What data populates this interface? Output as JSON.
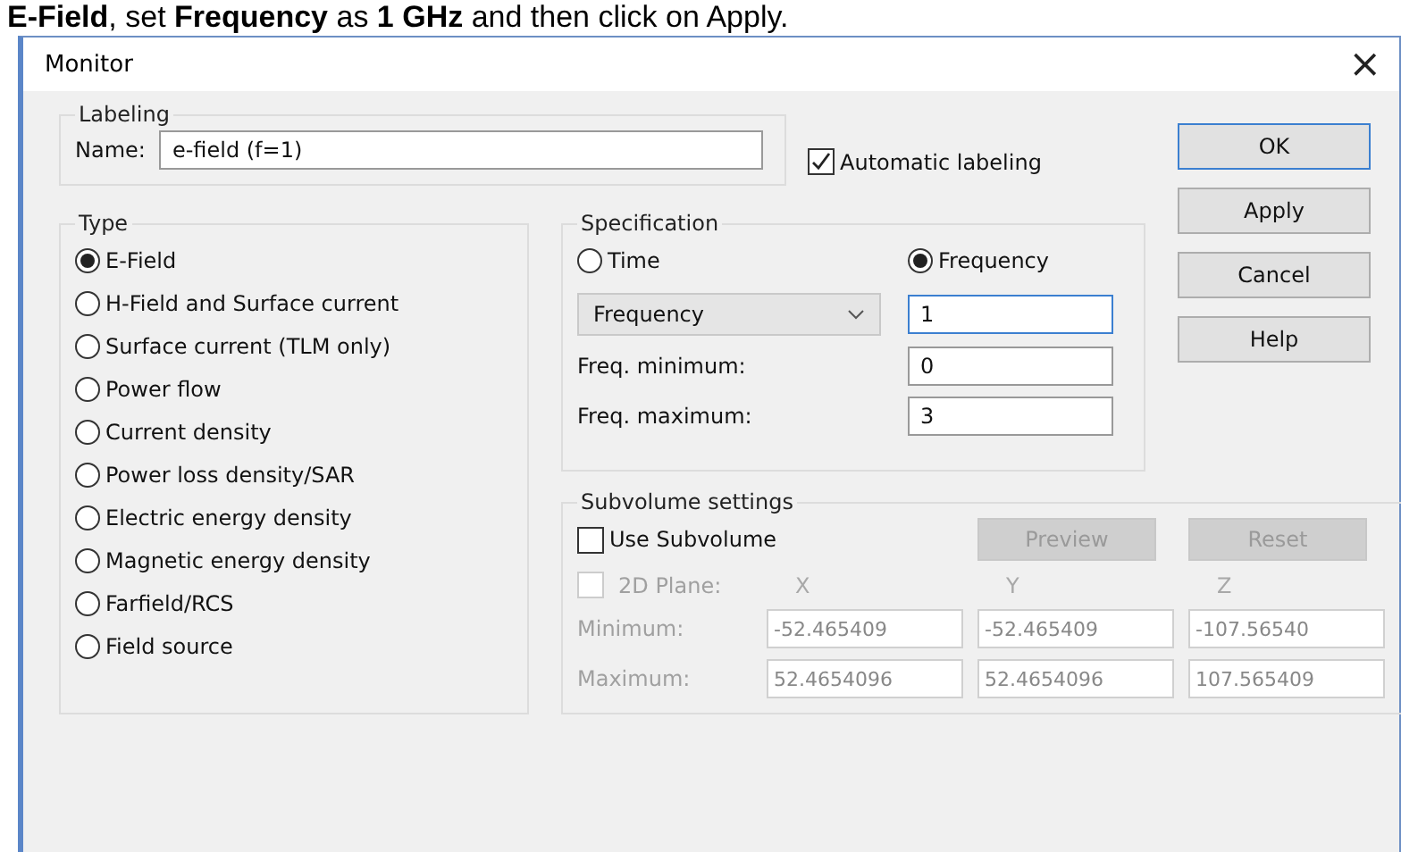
{
  "caption": "**E-Field**, set **Frequency** as **1 GHz** and then click on Apply.",
  "window": {
    "title": "Monitor",
    "close": "×"
  },
  "labeling": {
    "title": "Labeling",
    "name_label": "Name:",
    "name_value": "e-field (f=1)",
    "auto": {
      "label": "Automatic labeling",
      "checked": true
    }
  },
  "buttons": [
    {
      "label": "OK",
      "default": true
    },
    {
      "label": "Apply",
      "default": false
    },
    {
      "label": "Cancel",
      "default": false
    },
    {
      "label": "Help",
      "default": false
    }
  ],
  "type": {
    "title": "Type",
    "options": [
      {
        "label": "E-Field",
        "selected": true
      },
      {
        "label": "H-Field and Surface current",
        "selected": false
      },
      {
        "label": "Surface current (TLM only)",
        "selected": false
      },
      {
        "label": "Power flow",
        "selected": false
      },
      {
        "label": "Current density",
        "selected": false
      },
      {
        "label": "Power loss density/SAR",
        "selected": false
      },
      {
        "label": "Electric energy density",
        "selected": false
      },
      {
        "label": "Magnetic energy density",
        "selected": false
      },
      {
        "label": "Farfield/RCS",
        "selected": false
      },
      {
        "label": "Field source",
        "selected": false
      }
    ]
  },
  "specification": {
    "title": "Specification",
    "modes": [
      {
        "label": "Time",
        "selected": false
      },
      {
        "label": "Frequency",
        "selected": true
      }
    ],
    "dropdown": "Frequency",
    "value": "1",
    "fields": [
      {
        "label": "Freq. minimum:",
        "value": "0"
      },
      {
        "label": "Freq. maximum:",
        "value": "3"
      }
    ]
  },
  "subvolume": {
    "title": "Subvolume settings",
    "use": {
      "label": "Use Subvolume",
      "checked": false
    },
    "buttons": [
      {
        "label": "Preview",
        "disabled": true
      },
      {
        "label": "Reset",
        "disabled": true
      }
    ],
    "plane": {
      "label": "2D Plane:",
      "checked": false,
      "disabled": true
    },
    "axes": [
      "X",
      "Y",
      "Z"
    ],
    "rows": [
      {
        "label": "Minimum:",
        "values": [
          "-52.465409",
          "-52.465409",
          "-107.56540"
        ]
      },
      {
        "label": "Maximum:",
        "values": [
          "52.4654096",
          "52.4654096",
          "107.565409"
        ]
      }
    ]
  }
}
